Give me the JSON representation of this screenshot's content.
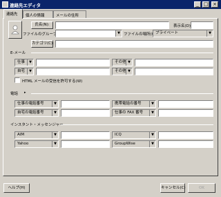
{
  "window": {
    "title": "連絡先エディタ",
    "controls": [
      "_",
      "□",
      "×"
    ]
  },
  "tabs": [
    "連絡先",
    "個人の情報",
    "メールの住所"
  ],
  "contact": {
    "name_button": "氏名(N):",
    "name_value": "",
    "display_name_label": "表示名(D):",
    "display_name_value": "",
    "file_as_label": "ファイルのグループ(E):",
    "file_as_value": "",
    "file_where_label": "ファイルの場所(W):",
    "file_where_value": "プライベート",
    "category_button": "カテゴリ(C):",
    "category_value": ""
  },
  "email": {
    "section_label": "E-メール",
    "rows": [
      {
        "type": "仕事",
        "value": "",
        "type2": "その他",
        "value2": ""
      },
      {
        "type": "自宅",
        "value": "",
        "type2": "その他",
        "value2": ""
      }
    ],
    "html_pref_label": "HTML メールの受信を許可する(W)"
  },
  "phone": {
    "section_label": "電話",
    "rows": [
      {
        "type": "仕事の電話番号",
        "value": "",
        "type2": "携帯電話の番号",
        "value2": ""
      },
      {
        "type": "自宅の電話番号",
        "value": "",
        "type2": "仕事の FAX 番号",
        "value2": ""
      }
    ]
  },
  "im": {
    "section_label": "インスタント・メッセンジャー",
    "rows": [
      {
        "type": "AIM",
        "value": "",
        "type2": "ICQ",
        "value2": ""
      },
      {
        "type": "Yahoo",
        "value": "",
        "type2": "GroupWise",
        "value2": ""
      }
    ]
  },
  "footer": {
    "help_button": "ヘルプ(H)",
    "cancel_button": "キャンセル(C)",
    "ok_button": "OK"
  }
}
